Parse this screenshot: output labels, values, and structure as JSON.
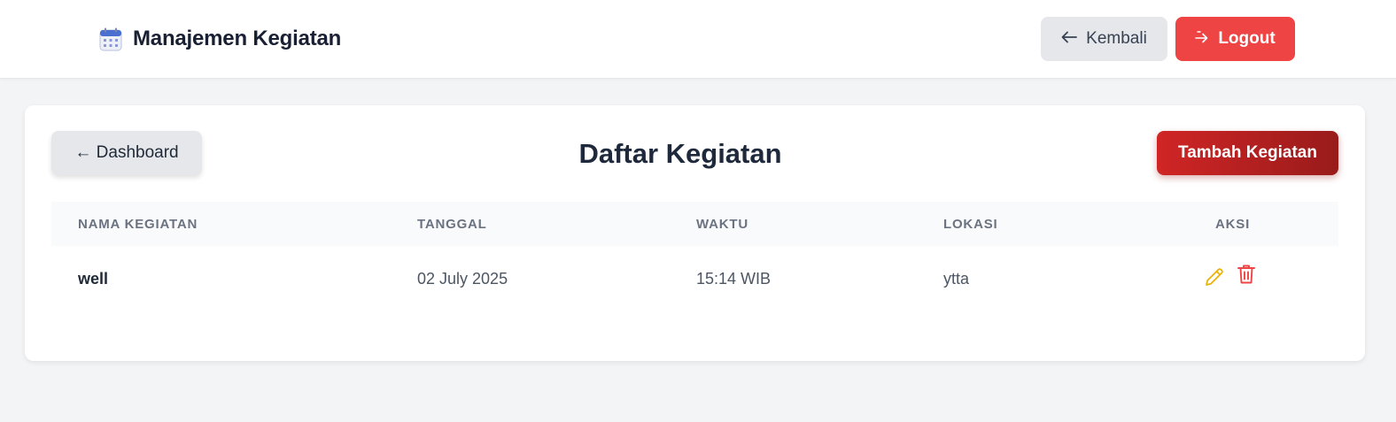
{
  "header": {
    "app_title": "Manajemen Kegiatan",
    "brand_icon": "calendar-icon",
    "back_label": "Kembali",
    "logout_label": "Logout"
  },
  "main": {
    "dashboard_label": "← Dashboard",
    "title": "Daftar Kegiatan",
    "add_label": "Tambah Kegiatan",
    "table": {
      "columns": [
        "NAMA KEGIATAN",
        "TANGGAL",
        "WAKTU",
        "LOKASI",
        "AKSI"
      ],
      "rows": [
        {
          "nama": "well",
          "tanggal": "02 July 2025",
          "waktu": "15:14 WIB",
          "lokasi": "ytta",
          "actions": [
            "edit-icon",
            "delete-icon"
          ]
        }
      ]
    }
  },
  "colors": {
    "primary_red": "#ef4444",
    "dark_red": "#991b1b",
    "edit_yellow": "#eab308",
    "delete_red": "#ef4444",
    "background": "#f3f4f6"
  }
}
